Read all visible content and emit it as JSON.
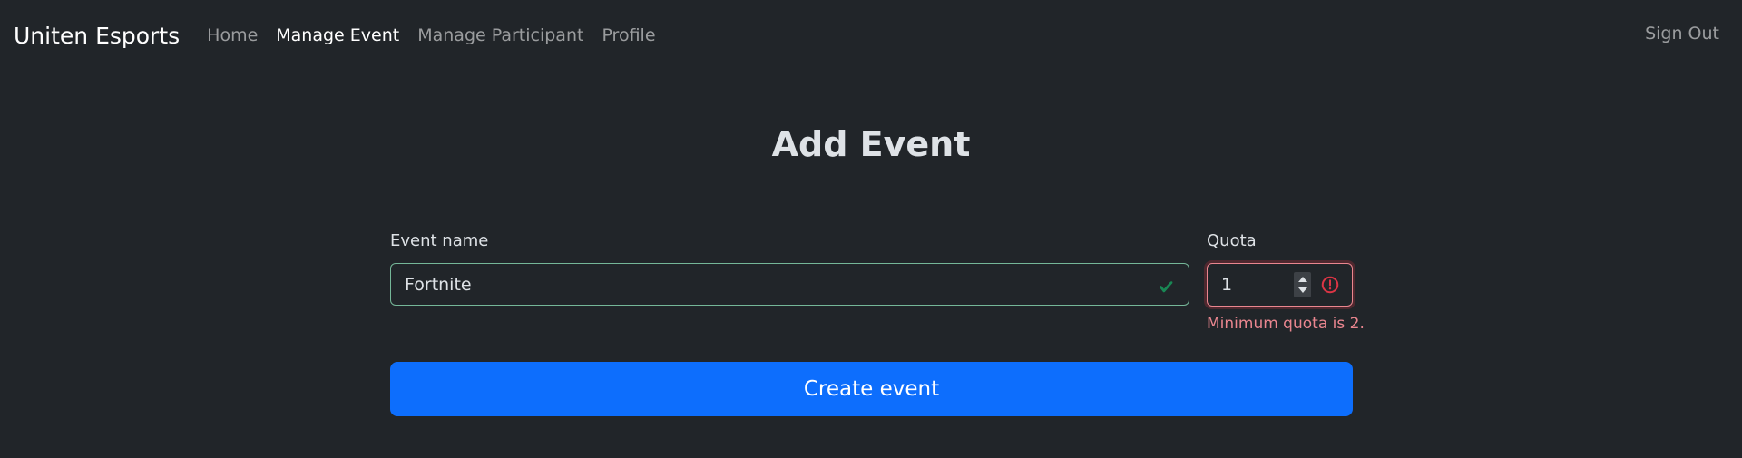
{
  "navbar": {
    "brand": "Uniten Esports",
    "links": [
      {
        "label": "Home",
        "active": false
      },
      {
        "label": "Manage Event",
        "active": true
      },
      {
        "label": "Manage Participant",
        "active": false
      },
      {
        "label": "Profile",
        "active": false
      }
    ],
    "sign_out": "Sign Out"
  },
  "page": {
    "title": "Add Event"
  },
  "form": {
    "event_name": {
      "label": "Event name",
      "value": "Fortnite",
      "state": "valid",
      "icon": "check-icon"
    },
    "quota": {
      "label": "Quota",
      "value": "1",
      "state": "invalid",
      "icon": "exclamation-circle-icon",
      "feedback": "Minimum quota is 2."
    },
    "submit_label": "Create event"
  },
  "colors": {
    "background": "#212529",
    "primary": "#0d6efd",
    "valid": "#75b798",
    "valid_icon": "#198754",
    "invalid": "#ea868f",
    "invalid_icon": "#dc3545"
  }
}
